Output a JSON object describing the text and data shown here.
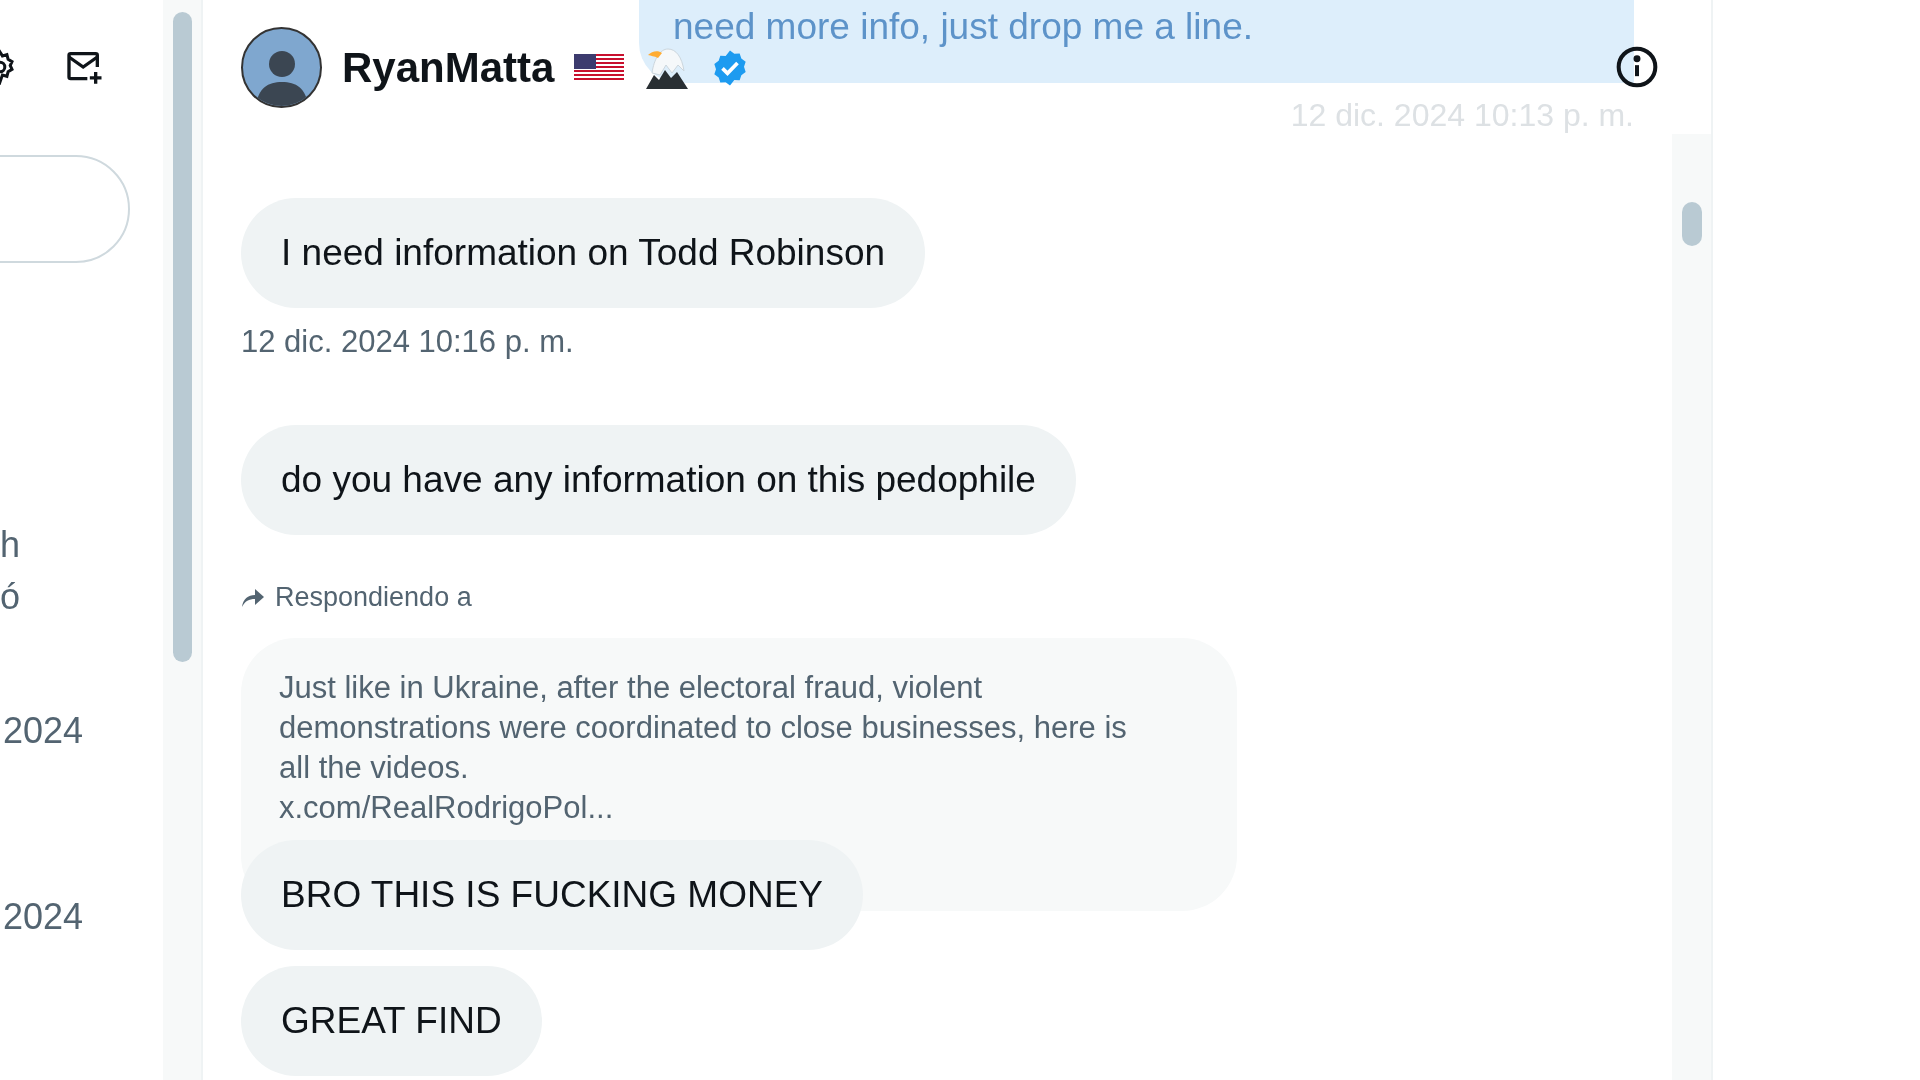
{
  "sidebar": {
    "fragments": [
      "h",
      "ó",
      "2024",
      "2024"
    ]
  },
  "header": {
    "name": "RyanMatta",
    "verified": true
  },
  "messages": [
    {
      "kind": "sent",
      "text": "need more info, just drop me a line.",
      "timestamp": "12 dic. 2024 10:13 p. m."
    },
    {
      "kind": "received",
      "text": "I need information on Todd Robinson",
      "timestamp": "12 dic. 2024 10:16 p. m."
    },
    {
      "kind": "received",
      "text": "do you have any information on this pedophile"
    },
    {
      "kind": "quote",
      "label": "Respondiendo a",
      "text": "Just like in Ukraine, after the electoral fraud, violent demonstrations were coordinated to close businesses, here is all the videos.",
      "link": "x.com/RealRodrigoPol..."
    },
    {
      "kind": "received",
      "text": "BRO THIS IS FUCKING MONEY"
    },
    {
      "kind": "received",
      "text": "GREAT FIND"
    }
  ]
}
